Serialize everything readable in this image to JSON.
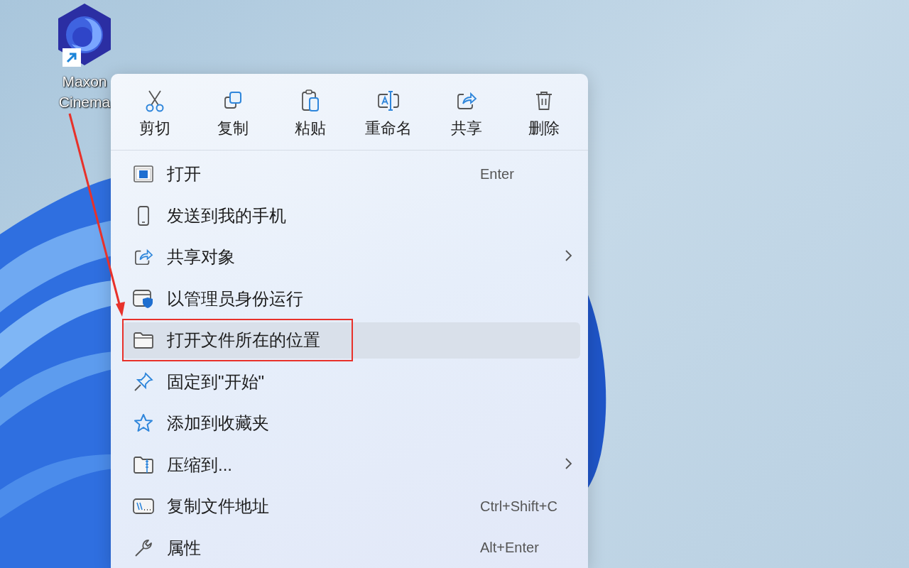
{
  "desktop_icon": {
    "label": "Maxon Cinema",
    "shortcut": true
  },
  "context_menu": {
    "toolbar": [
      {
        "label": "剪切"
      },
      {
        "label": "复制"
      },
      {
        "label": "粘贴"
      },
      {
        "label": "重命名"
      },
      {
        "label": "共享"
      },
      {
        "label": "删除"
      }
    ],
    "items": [
      {
        "label": "打开",
        "shortcut": "Enter",
        "submenu": false,
        "selected": false,
        "annotated": false
      },
      {
        "label": "发送到我的手机",
        "submenu": false,
        "selected": false,
        "annotated": false
      },
      {
        "label": "共享对象",
        "submenu": true,
        "selected": false,
        "annotated": false
      },
      {
        "label": "以管理员身份运行",
        "submenu": false,
        "selected": false,
        "annotated": false
      },
      {
        "label": "打开文件所在的位置",
        "submenu": false,
        "selected": true,
        "annotated": true
      },
      {
        "label": "固定到\"开始\"",
        "submenu": false,
        "selected": false,
        "annotated": false
      },
      {
        "label": "添加到收藏夹",
        "submenu": false,
        "selected": false,
        "annotated": false
      },
      {
        "label": "压缩到...",
        "submenu": true,
        "selected": false,
        "annotated": false
      },
      {
        "label": "复制文件地址",
        "shortcut": "Ctrl+Shift+C",
        "submenu": false,
        "selected": false,
        "annotated": false
      },
      {
        "label": "属性",
        "shortcut": "Alt+Enter",
        "submenu": false,
        "selected": false,
        "annotated": false
      }
    ]
  }
}
